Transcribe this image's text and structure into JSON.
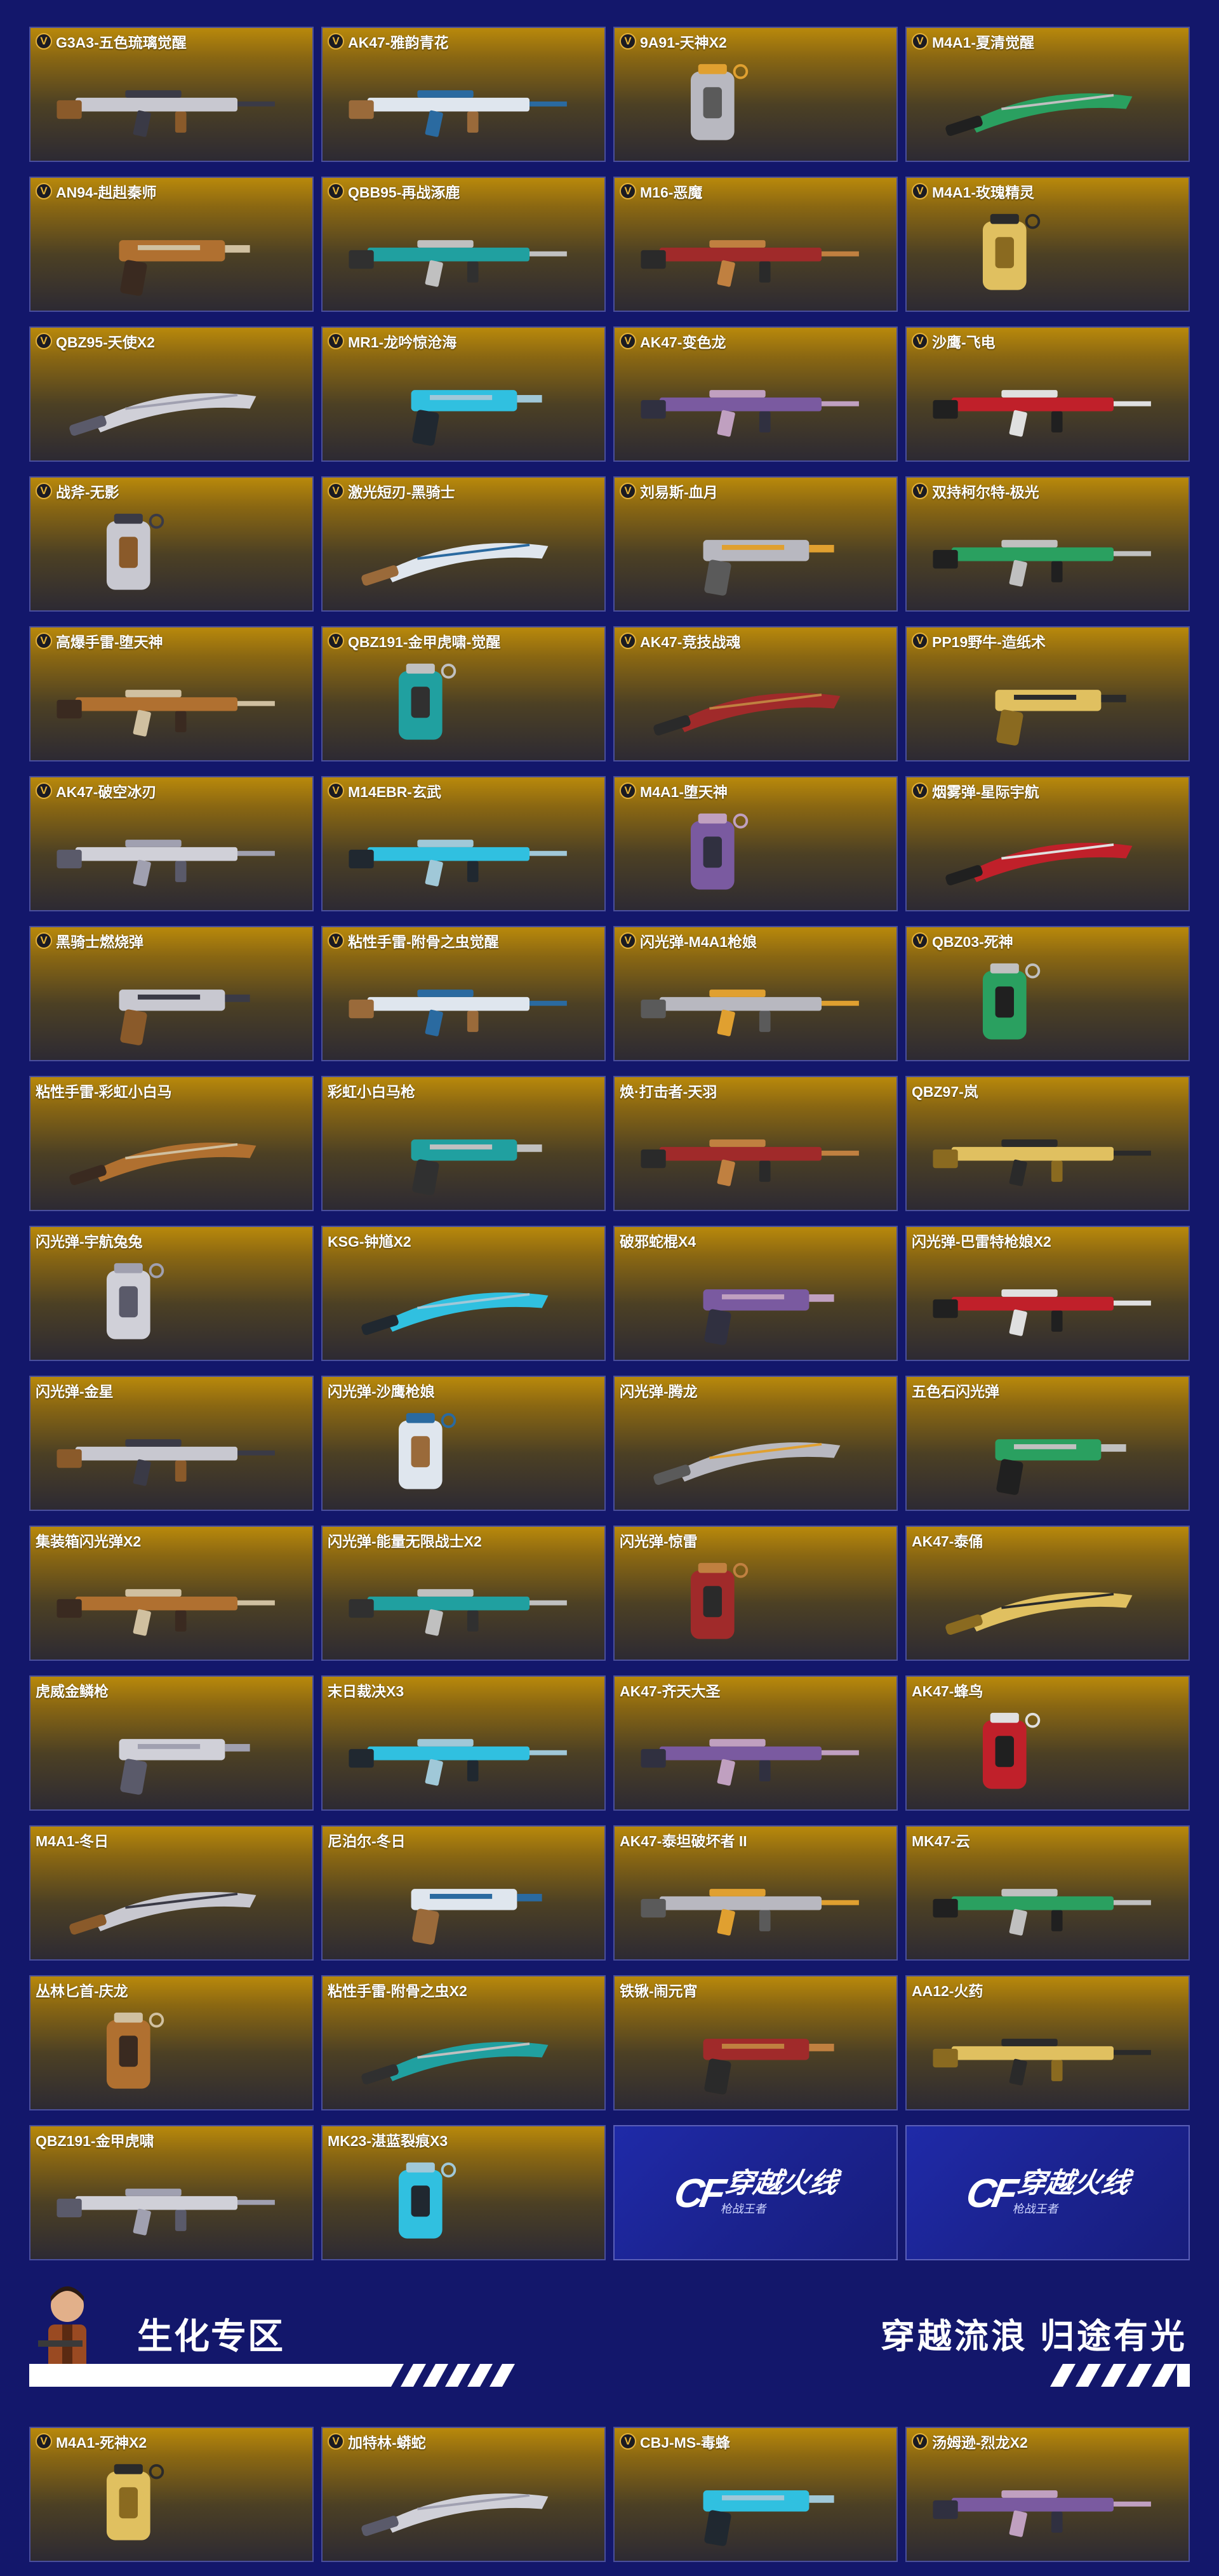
{
  "colors": {
    "background": "#13176b",
    "card_top": "#b9890b",
    "card_bottom": "#2d2a33",
    "badge_gold": "#e9b638",
    "logo_blue": "#1f2aa8"
  },
  "badge_letter": "V",
  "items": [
    {
      "name": "G3A3-五色琉璃觉醒",
      "v": true
    },
    {
      "name": "AK47-雅韵青花",
      "v": true
    },
    {
      "name": "9A91-天神X2",
      "v": true
    },
    {
      "name": "M4A1-夏清觉醒",
      "v": true
    },
    {
      "name": "AN94-赳赳秦师",
      "v": true
    },
    {
      "name": "QBB95-再战涿鹿",
      "v": true
    },
    {
      "name": "M16-恶魔",
      "v": true
    },
    {
      "name": "M4A1-玫瑰精灵",
      "v": true
    },
    {
      "name": "QBZ95-天使X2",
      "v": true
    },
    {
      "name": "MR1-龙吟惊沧海",
      "v": true
    },
    {
      "name": "AK47-变色龙",
      "v": true
    },
    {
      "name": "沙鹰-飞电",
      "v": true
    },
    {
      "name": "战斧-无影",
      "v": true
    },
    {
      "name": "激光短刃-黑骑士",
      "v": true
    },
    {
      "name": "刘易斯-血月",
      "v": true
    },
    {
      "name": "双持柯尔特-极光",
      "v": true
    },
    {
      "name": "高爆手雷-堕天神",
      "v": true
    },
    {
      "name": "QBZ191-金甲虎啸-觉醒",
      "v": true
    },
    {
      "name": "AK47-竞技战魂",
      "v": true
    },
    {
      "name": "PP19野牛-造纸术",
      "v": true
    },
    {
      "name": "AK47-破空冰刃",
      "v": true
    },
    {
      "name": "M14EBR-玄武",
      "v": true
    },
    {
      "name": "M4A1-堕天神",
      "v": true
    },
    {
      "name": "烟雾弹-星际宇航",
      "v": true
    },
    {
      "name": "黑骑士燃烧弹",
      "v": true
    },
    {
      "name": "粘性手雷-附骨之虫觉醒",
      "v": true
    },
    {
      "name": "闪光弹-M4A1枪娘",
      "v": true
    },
    {
      "name": "QBZ03-死神",
      "v": true
    },
    {
      "name": "粘性手雷-彩虹小白马",
      "v": false
    },
    {
      "name": "彩虹小白马枪",
      "v": false
    },
    {
      "name": "焕·打击者-天羽",
      "v": false
    },
    {
      "name": "QBZ97-岚",
      "v": false
    },
    {
      "name": "闪光弹-宇航兔兔",
      "v": false
    },
    {
      "name": "KSG-钟馗X2",
      "v": false
    },
    {
      "name": "破邪蛇棍X4",
      "v": false
    },
    {
      "name": "闪光弹-巴雷特枪娘X2",
      "v": false
    },
    {
      "name": "闪光弹-金星",
      "v": false
    },
    {
      "name": "闪光弹-沙鹰枪娘",
      "v": false
    },
    {
      "name": "闪光弹-腾龙",
      "v": false
    },
    {
      "name": "五色石闪光弹",
      "v": false
    },
    {
      "name": "集装箱闪光弹X2",
      "v": false
    },
    {
      "name": "闪光弹-能量无限战士X2",
      "v": false
    },
    {
      "name": "闪光弹-惊雷",
      "v": false
    },
    {
      "name": "AK47-泰俑",
      "v": false
    },
    {
      "name": "虎威金鳞枪",
      "v": false
    },
    {
      "name": "末日裁决X3",
      "v": false
    },
    {
      "name": "AK47-齐天大圣",
      "v": false
    },
    {
      "name": "AK47-蜂鸟",
      "v": false
    },
    {
      "name": "M4A1-冬日",
      "v": false
    },
    {
      "name": "尼泊尔-冬日",
      "v": false
    },
    {
      "name": "AK47-泰坦破坏者 II",
      "v": false
    },
    {
      "name": "MK47-云",
      "v": false
    },
    {
      "name": "丛林匕首-庆龙",
      "v": false
    },
    {
      "name": "粘性手雷-附骨之虫X2",
      "v": false
    },
    {
      "name": "铁锹-闹元宵",
      "v": false
    },
    {
      "name": "AA12-火药",
      "v": false
    },
    {
      "name": "QBZ191-金甲虎啸",
      "v": false
    },
    {
      "name": "MK23-湛蓝裂痕X3",
      "v": false
    }
  ],
  "logo": {
    "brand_mark": "CF",
    "brand_name": "穿越火线",
    "brand_sub": "枪战王者"
  },
  "section": {
    "title": "生化专区",
    "slogan": "穿越流浪 归途有光"
  },
  "section_items": [
    {
      "name": "M4A1-死神X2",
      "v": true
    },
    {
      "name": "加特林-蟒蛇",
      "v": true
    },
    {
      "name": "CBJ-MS-毒蜂",
      "v": true
    },
    {
      "name": "汤姆逊-烈龙X2",
      "v": true
    }
  ]
}
